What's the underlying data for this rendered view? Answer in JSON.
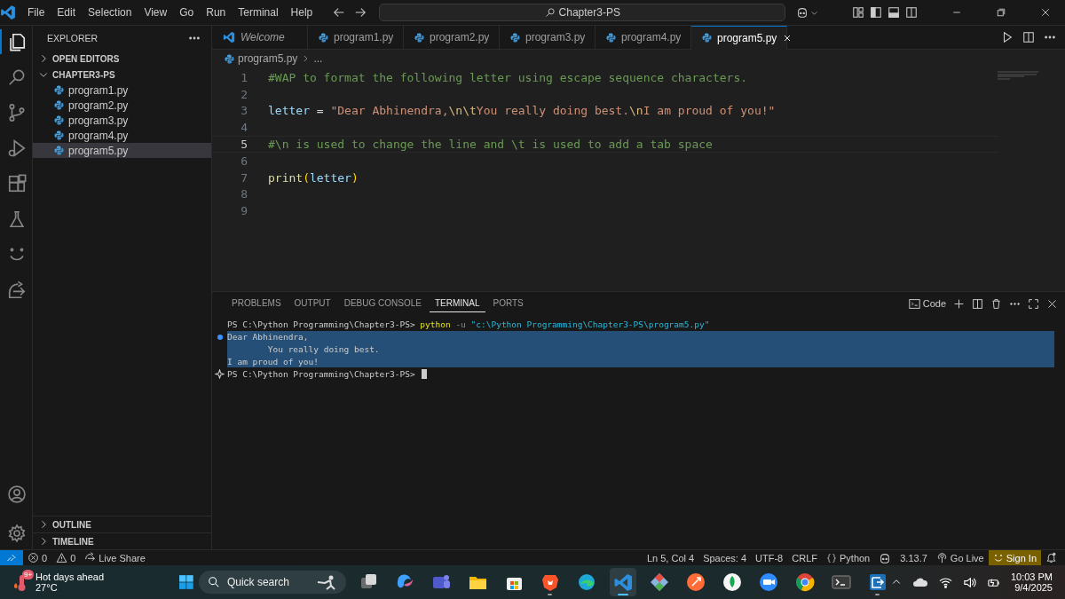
{
  "menu": [
    "File",
    "Edit",
    "Selection",
    "View",
    "Go",
    "Run",
    "Terminal",
    "Help"
  ],
  "command_center": {
    "value": "Chapter3-PS"
  },
  "activity_bar": {
    "top": [
      {
        "kind": "explorer",
        "selected": true
      },
      {
        "kind": "search",
        "selected": false
      },
      {
        "kind": "source-control",
        "selected": false
      },
      {
        "kind": "run-debug",
        "selected": false
      },
      {
        "kind": "extensions",
        "selected": false
      },
      {
        "kind": "testing",
        "selected": false
      },
      {
        "kind": "smile",
        "selected": false
      },
      {
        "kind": "live-share",
        "selected": false
      }
    ],
    "bottom": [
      {
        "kind": "account",
        "selected": false
      },
      {
        "kind": "settings",
        "selected": false
      }
    ]
  },
  "sidebar": {
    "title": "EXPLORER",
    "sections": [
      {
        "label": "OPEN EDITORS",
        "expanded": false
      },
      {
        "label": "CHAPTER3-PS",
        "expanded": true,
        "items": [
          {
            "label": "program1.py",
            "selected": false
          },
          {
            "label": "program2.py",
            "selected": false
          },
          {
            "label": "program3.py",
            "selected": false
          },
          {
            "label": "program4.py",
            "selected": false
          },
          {
            "label": "program5.py",
            "selected": true
          }
        ]
      }
    ],
    "bottom_sections": [
      {
        "label": "OUTLINE",
        "expanded": false
      },
      {
        "label": "TIMELINE",
        "expanded": false
      }
    ]
  },
  "tabs": [
    {
      "label": "Welcome",
      "kind": "welcome",
      "selected": false
    },
    {
      "label": "program1.py",
      "kind": "python",
      "selected": false
    },
    {
      "label": "program2.py",
      "kind": "python",
      "selected": false
    },
    {
      "label": "program3.py",
      "kind": "python",
      "selected": false
    },
    {
      "label": "program4.py",
      "kind": "python",
      "selected": false
    },
    {
      "label": "program5.py",
      "kind": "python",
      "selected": true
    }
  ],
  "breadcrumb": [
    "program5.py",
    "..."
  ],
  "code_lines": [
    {
      "number": "1",
      "current": false,
      "tokens": [
        {
          "kind": "comment",
          "text": "#WAP to format the following letter using escape sequence characters."
        }
      ]
    },
    {
      "number": "2",
      "current": false
    },
    {
      "number": "3",
      "current": false,
      "tokens": [
        {
          "kind": "variable",
          "text": "letter"
        },
        {
          "kind": "operator",
          "text": " = "
        },
        {
          "kind": "string",
          "text": "\"Dear Abhinendra,"
        },
        {
          "kind": "escape",
          "text": "\\n\\t"
        },
        {
          "kind": "string",
          "text": "You really doing best."
        },
        {
          "kind": "escape",
          "text": "\\n"
        },
        {
          "kind": "string",
          "text": "I am proud of you!\""
        }
      ]
    },
    {
      "number": "4",
      "current": false
    },
    {
      "number": "5",
      "current": true,
      "tokens": [
        {
          "kind": "comment",
          "text": "#\\n is used to change the line and \\t is used to add a tab space"
        }
      ]
    },
    {
      "number": "6",
      "current": false
    },
    {
      "number": "7",
      "current": false,
      "tokens": [
        {
          "kind": "function",
          "text": "print"
        },
        {
          "kind": "bracket",
          "text": "("
        },
        {
          "kind": "variable",
          "text": "letter"
        },
        {
          "kind": "bracket",
          "text": ")"
        }
      ]
    },
    {
      "number": "8",
      "current": false
    },
    {
      "number": "9",
      "current": false
    }
  ],
  "panel": {
    "tabs": [
      {
        "label": "PROBLEMS",
        "selected": false
      },
      {
        "label": "OUTPUT",
        "selected": false
      },
      {
        "label": "DEBUG CONSOLE",
        "selected": false
      },
      {
        "label": "TERMINAL",
        "selected": true
      },
      {
        "label": "PORTS",
        "selected": false
      }
    ],
    "terminal_name": "Code",
    "lines": [
      {
        "selected": false,
        "tokens": [
          {
            "kind": "prompt",
            "text": "PS C:\\Python Programming\\Chapter3-PS> "
          },
          {
            "kind": "command",
            "text": "python"
          },
          {
            "kind": "flag",
            "text": " -u "
          },
          {
            "kind": "string",
            "text": "\"c:\\Python Programming\\Chapter3-PS\\program5.py\""
          }
        ]
      },
      {
        "kind": "dot",
        "selected": true,
        "tokens": [
          {
            "kind": "output",
            "text": "Dear Abhinendra,"
          }
        ]
      },
      {
        "selected": true,
        "tokens": [
          {
            "kind": "output",
            "text": "\tYou really doing best."
          }
        ]
      },
      {
        "selected": true,
        "tokens": [
          {
            "kind": "output",
            "text": "I am proud of you!"
          }
        ]
      },
      {
        "kind": "sparkle",
        "selected": false,
        "tokens": [
          {
            "kind": "prompt",
            "text": "PS C:\\Python Programming\\Chapter3-PS> "
          }
        ]
      }
    ]
  },
  "status_bar": {
    "left": [
      {
        "kind": "error",
        "text": "0",
        "highlighted": false
      },
      {
        "kind": "warning",
        "text": "0",
        "highlighted": false
      },
      {
        "kind": "live-share",
        "text": "Live Share",
        "highlighted": false
      }
    ],
    "right": [
      {
        "text": "Ln 5, Col 4",
        "highlighted": false
      },
      {
        "text": "Spaces: 4",
        "highlighted": false
      },
      {
        "text": "UTF-8",
        "highlighted": false
      },
      {
        "text": "CRLF",
        "highlighted": false
      },
      {
        "kind": "braces",
        "text": "Python",
        "highlighted": false
      },
      {
        "kind": "copilot",
        "highlighted": false
      },
      {
        "text": "3.13.7",
        "highlighted": false
      },
      {
        "kind": "broadcast",
        "text": "Go Live",
        "highlighted": false
      },
      {
        "kind": "smile",
        "text": "Sign In",
        "highlighted": true
      },
      {
        "kind": "bell",
        "highlighted": false
      }
    ]
  },
  "taskbar": {
    "weather": {
      "badge": "9+",
      "title": "Hot days ahead",
      "temperature": "27°C"
    },
    "search": {
      "placeholder": "Quick search"
    },
    "apps": [
      {
        "kind": "task-view",
        "running": false,
        "selected": false
      },
      {
        "kind": "copilot",
        "running": false,
        "selected": false
      },
      {
        "kind": "teams",
        "running": false,
        "selected": false
      },
      {
        "kind": "folder",
        "running": false,
        "selected": false
      },
      {
        "kind": "store",
        "running": false,
        "selected": false
      },
      {
        "kind": "brave",
        "running": true,
        "selected": false
      },
      {
        "kind": "edge",
        "running": false,
        "selected": false
      },
      {
        "kind": "vscode",
        "running": true,
        "selected": true
      },
      {
        "kind": "git",
        "running": false,
        "selected": false
      },
      {
        "kind": "postman",
        "running": false,
        "selected": false
      },
      {
        "kind": "leaf",
        "running": false,
        "selected": false
      },
      {
        "kind": "video",
        "running": false,
        "selected": false
      },
      {
        "kind": "chrome",
        "running": false,
        "selected": false
      },
      {
        "kind": "terminal",
        "running": false,
        "selected": false
      },
      {
        "kind": "transfer",
        "running": true,
        "selected": false
      }
    ],
    "time": "10:03 PM",
    "date": "9/4/2025"
  }
}
